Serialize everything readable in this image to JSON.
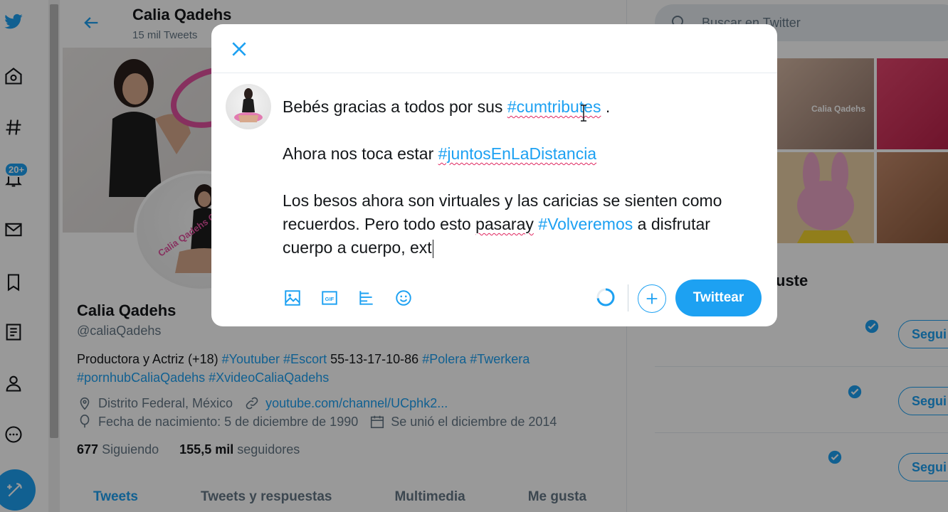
{
  "header": {
    "name": "Calia Qadehs",
    "tweet_count": "15 mil Tweets"
  },
  "nav": {
    "badge": "20+"
  },
  "profile": {
    "name": "Calia Qadehs",
    "handle": "@caliaQadehs",
    "bio_text": "Productora y Actriz (+18)",
    "bio_tags_1": [
      "#Youtuber",
      "#Escort"
    ],
    "bio_phone": "55-13-17-10-86",
    "bio_tags_2": [
      "#Polera",
      "#Twerkera"
    ],
    "bio_tags_3": [
      "#pornhubCaliaQadehs",
      "#XvideoCaliaQadehs"
    ],
    "location": "Distrito Federal, México",
    "website": "youtube.com/channel/UCphk2...",
    "birthday": "Fecha de nacimiento: 5 de diciembre de 1990",
    "joined": "Se unió el diciembre de 2014",
    "following_count": "677",
    "following_label": "Siguiendo",
    "followers_count": "155,5 mil",
    "followers_label": "seguidores",
    "avatar_watermark": "Calia Qadehs Oficial"
  },
  "tabs": [
    "Tweets",
    "Tweets y respuestas",
    "Multimedia",
    "Me gusta"
  ],
  "sidebar": {
    "search_placeholder": "Buscar en Twitter",
    "media_watermark": "Calia Qadehs",
    "who_to_follow_title": "uste",
    "follow_label": "Segui"
  },
  "compose": {
    "line1_prefix": "Bebés gracias a todos por sus ",
    "line1_tag": "#cumtributes",
    "line1_suffix": " .",
    "line2_prefix": "Ahora nos toca estar ",
    "line2_tag": "#juntosEnLaDistancia",
    "line3_a": "Los besos ahora son virtuales y las caricias se sienten como recuerdos. Pero todo esto ",
    "line3_misspell": "pasaray",
    "line3_space": " ",
    "line3_tag": "#Volveremos",
    "line3_b": " a disfrutar cuerpo a cuerpo, ext",
    "tweet_button": "Twittear"
  },
  "colors": {
    "accent": "#1da1f2",
    "error_underline": "#e0245e"
  }
}
